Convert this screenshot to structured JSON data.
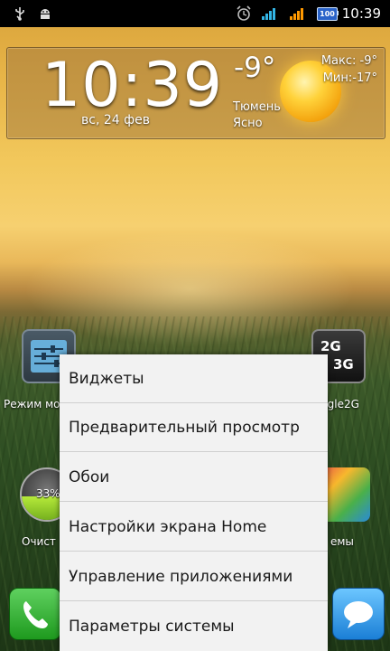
{
  "status_bar": {
    "time": "10:39",
    "battery_level": "100",
    "icons": [
      "usb-icon",
      "android-debug-icon",
      "alarm-icon",
      "signal-icon-1",
      "signal-icon-2",
      "battery-icon"
    ],
    "signal_color_1": "#33b5e5",
    "signal_color_2": "#ff9900"
  },
  "clock_widget": {
    "time": "10:39",
    "date": "вс, 24 фев",
    "temperature": "-9°",
    "city": "Тюмень",
    "condition": "Ясно",
    "max": "Макс: -9°",
    "min": "Мин:-17°",
    "weather_icon": "sun-icon"
  },
  "home_icons": [
    {
      "label": "Режим мо",
      "icon": "settings-sliders-icon"
    },
    {
      "label": "ggle2G",
      "icon": "toggle-2g-3g-icon",
      "badge_top": "2G",
      "badge_bottom": "3G"
    },
    {
      "label": "Очист",
      "icon": "cleaner-icon",
      "percent": "33%"
    },
    {
      "label": "емы",
      "icon": "themes-icon"
    }
  ],
  "dock": [
    {
      "icon": "phone-icon"
    },
    {
      "icon": "message-icon"
    }
  ],
  "context_menu": {
    "items": [
      "Виджеты",
      "Предварительный просмотр",
      "Обои",
      "Настройки экрана Home",
      "Управление приложениями",
      "Параметры системы"
    ]
  }
}
